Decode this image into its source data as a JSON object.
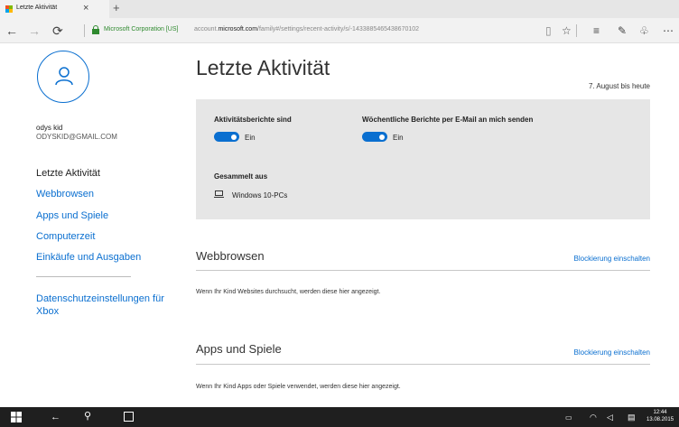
{
  "colors": {
    "accent": "#0a6fd0",
    "secure": "#2f8a2f",
    "panel": "#e6e6e6",
    "taskbar": "#1f1f1f"
  },
  "browser": {
    "tab_title": "Letzte Aktivität",
    "tab_close": "×",
    "new_tab": "+",
    "cert": "Microsoft Corporation [US]",
    "url_prefix": "account.",
    "url_domain": "microsoft.com",
    "url_path": "/family#/settings/recent-activity/s/-1433885465438670102",
    "icons": [
      "back-icon",
      "forward-icon",
      "refresh-icon",
      "lock-icon",
      "reading-view-icon",
      "favorite-star-icon",
      "hub-icon",
      "web-note-icon",
      "share-icon",
      "more-icon"
    ]
  },
  "sidebar": {
    "user_name": "odys kid",
    "user_email": "ODYSKID@GMAIL.COM",
    "items": [
      {
        "label": "Letzte Aktivität"
      },
      {
        "label": "Webbrowsen"
      },
      {
        "label": "Apps und Spiele"
      },
      {
        "label": "Computerzeit"
      },
      {
        "label": "Einkäufe und Ausgaben"
      }
    ],
    "privacy": "Datenschutzeinstellungen für Xbox"
  },
  "main": {
    "title": "Letzte Aktivität",
    "date_range": "7. August bis heute",
    "panel": {
      "activity_label": "Aktivitätsberichte sind",
      "activity_state": "Ein",
      "weekly_label": "Wöchentliche Berichte per E-Mail an mich senden",
      "weekly_state": "Ein",
      "collected_label": "Gesammelt aus",
      "device": "Windows 10-PCs"
    },
    "sections": [
      {
        "title": "Webbrowsen",
        "action": "Blockierung einschalten",
        "desc": "Wenn Ihr Kind Websites durchsucht, werden diese hier angezeigt."
      },
      {
        "title": "Apps und Spiele",
        "action": "Blockierung einschalten",
        "desc": "Wenn Ihr Kind Apps oder Spiele verwendet, werden diese hier angezeigt."
      }
    ]
  },
  "taskbar": {
    "time": "12:44",
    "date": "13.08.2015",
    "icons": [
      "windows-start-icon",
      "back-icon",
      "search-icon",
      "task-view-icon",
      "battery-icon",
      "wifi-icon",
      "volume-icon",
      "notification-icon"
    ]
  }
}
